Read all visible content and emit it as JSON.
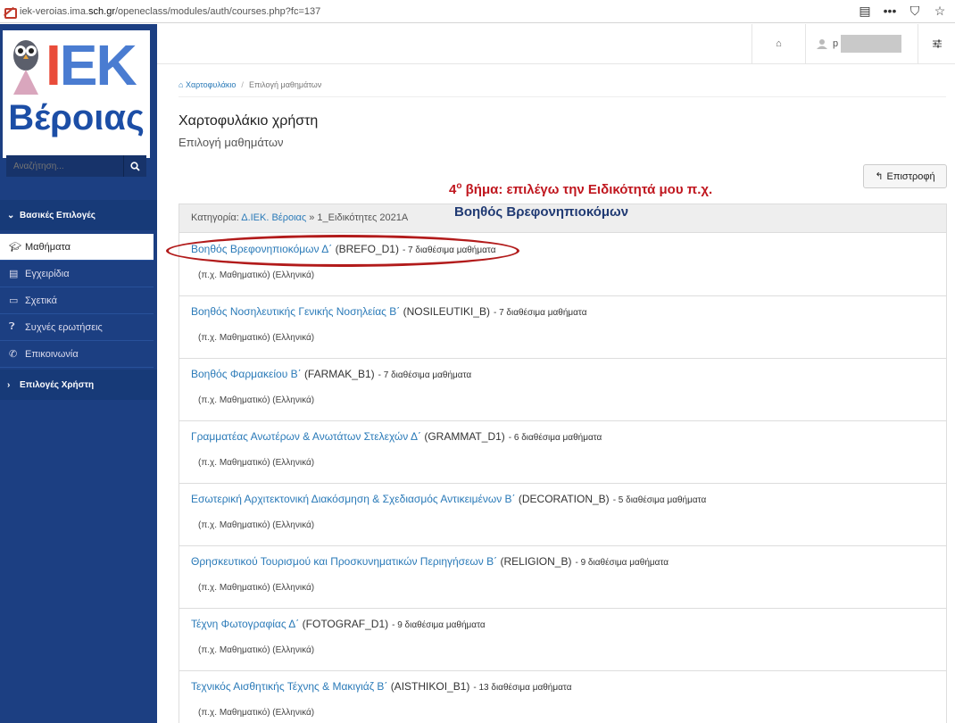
{
  "browser": {
    "url_prefix": "iek-veroias.ima.",
    "url_domain": "sch.gr",
    "url_path": "/openeclass/modules/auth/courses.php?fc=137"
  },
  "logo": {
    "brand": "IEK",
    "city": "Βέροιας"
  },
  "search": {
    "placeholder": "Αναζήτηση..."
  },
  "sidebar": {
    "basic_options": "Βασικές Επιλογές",
    "items": [
      {
        "label": "Μαθήματα",
        "icon": "graduation-cap-icon"
      },
      {
        "label": "Εγχειρίδια",
        "icon": "file-icon"
      },
      {
        "label": "Σχετικά",
        "icon": "card-icon"
      },
      {
        "label": "Συχνές ερωτήσεις",
        "icon": "question-icon"
      },
      {
        "label": "Επικοινωνία",
        "icon": "phone-icon"
      }
    ],
    "user_options": "Επιλογές Χρήστη"
  },
  "topbar": {
    "user_initial": "p"
  },
  "breadcrumb": {
    "home": "Χαρτοφυλάκιο",
    "current": "Επιλογή μαθημάτων"
  },
  "page": {
    "title": "Χαρτοφυλάκιο χρήστη",
    "subtitle": "Επιλογή μαθημάτων",
    "back_label": "Επιστροφή"
  },
  "annotation": {
    "step_num": "4",
    "step_sup": "ο",
    "line1": "βήμα: επιλέγω την Ειδικότητά μου π.χ.",
    "line2": "Βοηθός Βρεφονηπιοκόμων"
  },
  "category": {
    "prefix": "Κατηγορία:",
    "link": "Δ.ΙΕΚ. Βέροιας",
    "rest": "» 1_Ειδικότητες 2021Α"
  },
  "courses": [
    {
      "name": "Βοηθός Βρεφονηπιοκόμων Δ΄",
      "code": "(BREFO_D1)",
      "count": "- 7 διαθέσιμα μαθήματα",
      "meta": "(π.χ. Μαθηματικό) (Ελληνικά)"
    },
    {
      "name": "Βοηθός Νοσηλευτικής Γενικής Νοσηλείας Β΄",
      "code": "(NOSILEUTIKI_B)",
      "count": "- 7 διαθέσιμα μαθήματα",
      "meta": "(π.χ. Μαθηματικό) (Ελληνικά)"
    },
    {
      "name": "Βοηθός Φαρμακείου Β΄",
      "code": "(FARMAK_B1)",
      "count": "- 7 διαθέσιμα μαθήματα",
      "meta": "(π.χ. Μαθηματικό) (Ελληνικά)"
    },
    {
      "name": "Γραμματέας Ανωτέρων & Ανωτάτων Στελεχών Δ΄",
      "code": "(GRAMMAT_D1)",
      "count": "- 6 διαθέσιμα μαθήματα",
      "meta": "(π.χ. Μαθηματικό) (Ελληνικά)"
    },
    {
      "name": "Εσωτερική Αρχιτεκτονική Διακόσμηση & Σχεδιασμός Αντικειμένων Β΄",
      "code": "(DECORATION_B)",
      "count": "- 5 διαθέσιμα μαθήματα",
      "meta": "(π.χ. Μαθηματικό) (Ελληνικά)"
    },
    {
      "name": "Θρησκευτικού Τουρισμού και Προσκυνηματικών Περιηγήσεων Β΄",
      "code": "(RELIGION_B)",
      "count": "- 9 διαθέσιμα μαθήματα",
      "meta": "(π.χ. Μαθηματικό) (Ελληνικά)"
    },
    {
      "name": "Τέχνη Φωτογραφίας Δ΄",
      "code": "(FOTOGRAF_D1)",
      "count": "- 9 διαθέσιμα μαθήματα",
      "meta": "(π.χ. Μαθηματικό) (Ελληνικά)"
    },
    {
      "name": "Τεχνικός Αισθητικής Τέχνης & Μακιγιάζ Β΄",
      "code": "(AISTHIKOI_B1)",
      "count": "- 13 διαθέσιμα μαθήματα",
      "meta": "(π.χ. Μαθηματικό) (Ελληνικά)"
    }
  ]
}
